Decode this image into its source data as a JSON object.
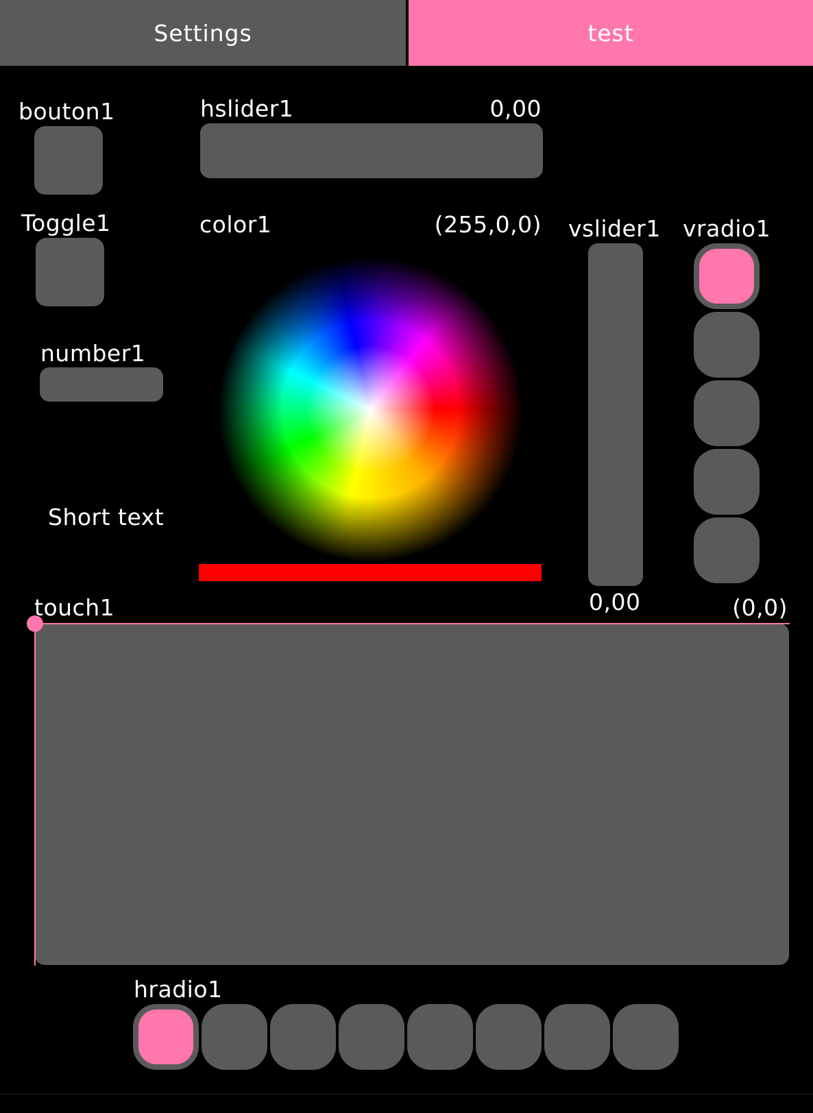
{
  "tabs": [
    {
      "label": "Settings",
      "active": false
    },
    {
      "label": "test",
      "active": true
    }
  ],
  "colors": {
    "accent": "#ff77ad",
    "control": "#5b5a5b",
    "background": "#000000",
    "color_value": "#ff0000"
  },
  "bouton1": {
    "label": "bouton1"
  },
  "hslider1": {
    "label": "hslider1",
    "value": "0,00",
    "level": 0
  },
  "toggle1": {
    "label": "Toggle1"
  },
  "color1": {
    "label": "color1",
    "value": "(255,0,0)"
  },
  "vslider1": {
    "label": "vslider1",
    "value": "0,00",
    "level": 0
  },
  "vradio1": {
    "label": "vradio1",
    "count": 5,
    "selected": 0
  },
  "number1": {
    "label": "number1"
  },
  "short_text": {
    "text": "Short text"
  },
  "touch1": {
    "label": "touch1",
    "value": "(0,0)"
  },
  "hradio1": {
    "label": "hradio1",
    "count": 8,
    "selected": 0
  }
}
